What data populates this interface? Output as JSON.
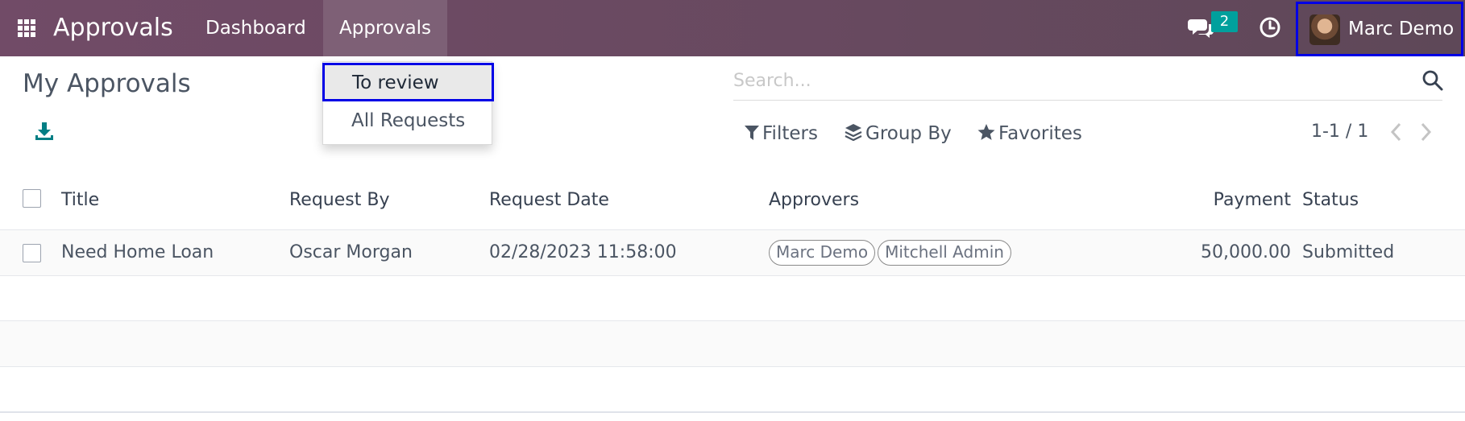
{
  "navbar": {
    "app_title": "Approvals",
    "menu": [
      "Dashboard",
      "Approvals"
    ],
    "chat_badge": "2",
    "user_name": "Marc Demo",
    "color": "#714b67"
  },
  "dropdown": {
    "items": [
      "To review",
      "All Requests"
    ]
  },
  "control_panel": {
    "title": "My Approvals",
    "search_placeholder": "Search...",
    "filters_label": "Filters",
    "groupby_label": "Group By",
    "favorites_label": "Favorites",
    "pager": "1-1 / 1"
  },
  "table": {
    "columns": [
      "Title",
      "Request By",
      "Request Date",
      "Approvers",
      "Payment",
      "Status"
    ],
    "rows": [
      {
        "title": "Need Home Loan",
        "request_by": "Oscar Morgan",
        "request_date": "02/28/2023 11:58:00",
        "approvers": [
          "Marc Demo",
          "Mitchell Admin"
        ],
        "payment": "50,000.00",
        "status": "Submitted"
      }
    ]
  },
  "colors": {
    "highlight_border": "#0000e6",
    "badge": "#00a09d",
    "download_icon": "#017e84"
  }
}
